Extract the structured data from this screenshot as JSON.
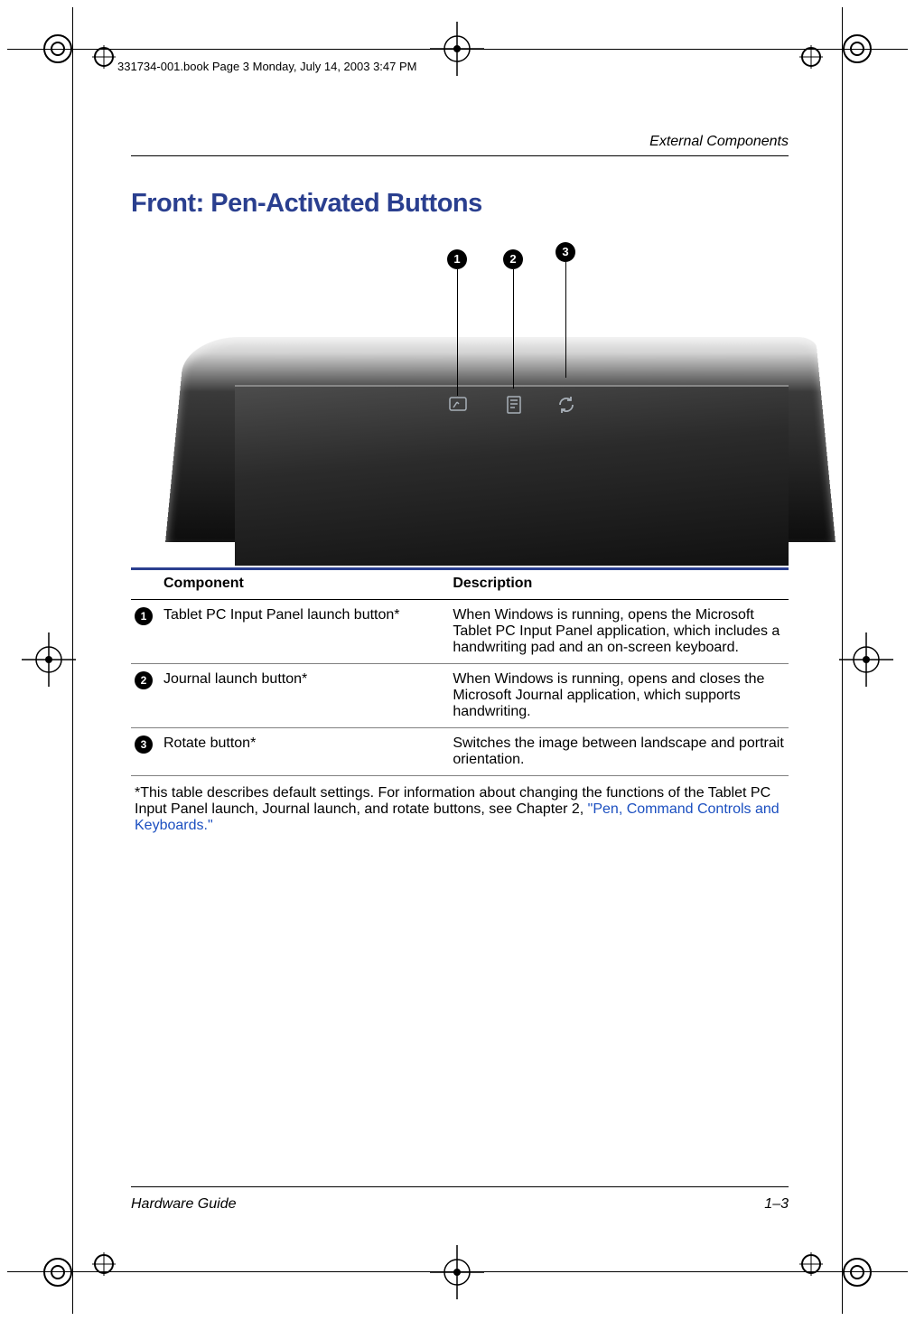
{
  "printer_header": "331734-001.book  Page 3  Monday, July 14, 2003  3:47 PM",
  "running_head": "External Components",
  "section_title": "Front: Pen-Activated Buttons",
  "callouts": {
    "c1": "1",
    "c2": "2",
    "c3": "3"
  },
  "table": {
    "headers": {
      "component": "Component",
      "description": "Description"
    },
    "rows": [
      {
        "num": "1",
        "component": "Tablet PC Input Panel launch button*",
        "description": "When Windows is running, opens the Microsoft Tablet PC Input Panel application, which includes a handwriting pad and an on-screen keyboard."
      },
      {
        "num": "2",
        "component": "Journal launch button*",
        "description": "When Windows is running, opens and closes the Microsoft Journal application, which supports handwriting."
      },
      {
        "num": "3",
        "component": "Rotate button*",
        "description": "Switches the image between landscape and portrait orientation."
      }
    ],
    "footnote_pre": "*This table describes default settings. For information about changing the functions of the Tablet PC Input Panel launch, Journal launch, and rotate buttons, see Chapter 2, ",
    "footnote_link": "\"Pen, Command Controls and Keyboards.\""
  },
  "footer": {
    "left": "Hardware Guide",
    "right": "1–3"
  }
}
